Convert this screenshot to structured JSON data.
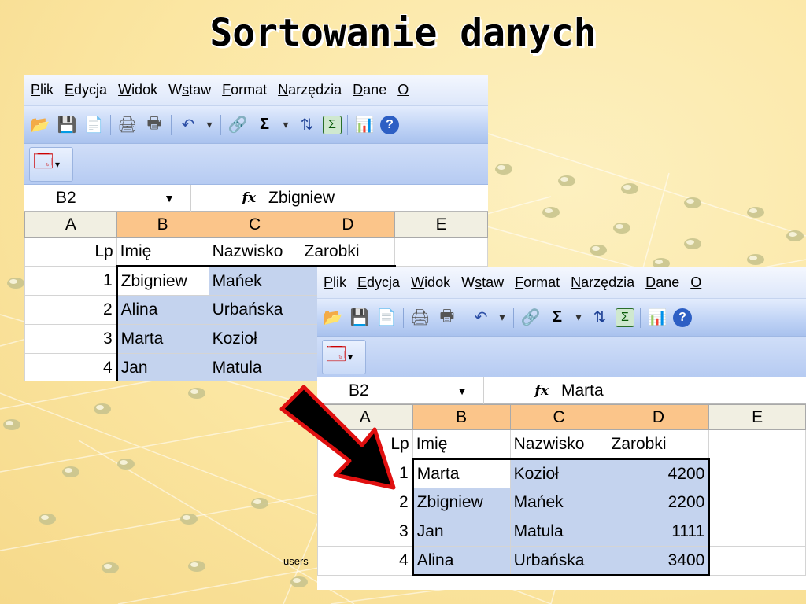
{
  "slide": {
    "title": "Sortowanie danych",
    "footer": "users"
  },
  "menu": [
    {
      "pre": "",
      "key": "P",
      "post": "lik"
    },
    {
      "pre": "",
      "key": "E",
      "post": "dycja"
    },
    {
      "pre": "",
      "key": "W",
      "post": "idok"
    },
    {
      "pre": "W",
      "key": "s",
      "post": "taw"
    },
    {
      "pre": "",
      "key": "F",
      "post": "ormat"
    },
    {
      "pre": "",
      "key": "N",
      "post": "arzędzia"
    },
    {
      "pre": "",
      "key": "D",
      "post": "ane"
    },
    {
      "pre": "",
      "key": "O",
      "post": ""
    }
  ],
  "toolbar_icons": [
    "open-folder-icon",
    "save-icon",
    "permission-icon",
    "print-preview-icon",
    "print-icon",
    "undo-icon",
    "undo-dropdown-icon",
    "hyperlink-icon",
    "autosum-icon",
    "autosum-dropdown-icon",
    "sort-ascending-icon",
    "function-icon",
    "chart-icon",
    "help-icon"
  ],
  "columns": [
    "A",
    "B",
    "C",
    "D",
    "E"
  ],
  "window_before": {
    "namebox": "B2",
    "fx_label": "fx",
    "formula": "Zbigniew",
    "header_row": [
      "Lp",
      "Imię",
      "Nazwisko",
      "Zarobki",
      ""
    ],
    "rows": [
      {
        "lp": "1",
        "imie": "Zbigniew",
        "nazwisko": "Mańek",
        "zarobki": ""
      },
      {
        "lp": "2",
        "imie": "Alina",
        "nazwisko": "Urbańska",
        "zarobki": ""
      },
      {
        "lp": "3",
        "imie": "Marta",
        "nazwisko": "Kozioł",
        "zarobki": ""
      },
      {
        "lp": "4",
        "imie": "Jan",
        "nazwisko": "Matula",
        "zarobki": ""
      }
    ]
  },
  "window_after": {
    "namebox": "B2",
    "fx_label": "fx",
    "formula": "Marta",
    "header_row": [
      "Lp",
      "Imię",
      "Nazwisko",
      "Zarobki",
      ""
    ],
    "rows": [
      {
        "lp": "1",
        "imie": "Marta",
        "nazwisko": "Kozioł",
        "zarobki": "4200"
      },
      {
        "lp": "2",
        "imie": "Zbigniew",
        "nazwisko": "Mańek",
        "zarobki": "2200"
      },
      {
        "lp": "3",
        "imie": "Jan",
        "nazwisko": "Matula",
        "zarobki": "1111"
      },
      {
        "lp": "4",
        "imie": "Alina",
        "nazwisko": "Urbańska",
        "zarobki": "3400"
      }
    ]
  },
  "colors": {
    "background": "#fbe6a2",
    "selection": "#c4d3ee",
    "selected_header": "#fbc58a",
    "arrow_fill": "#000000",
    "arrow_outline": "#e01010"
  }
}
